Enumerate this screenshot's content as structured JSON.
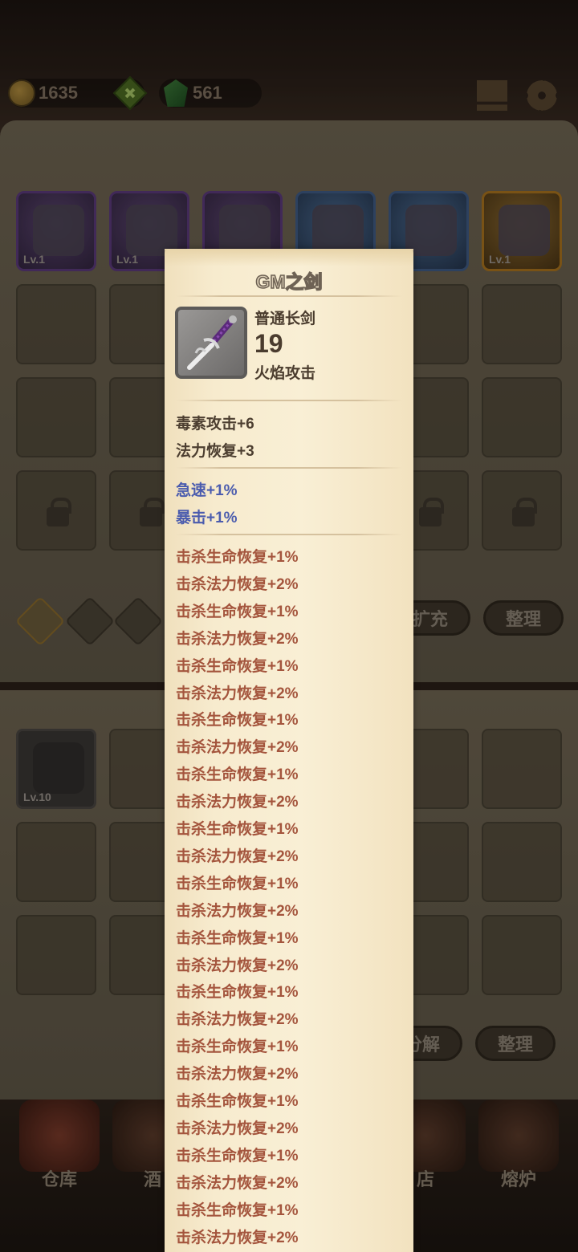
{
  "currency": {
    "gold": "1635",
    "gems": "561"
  },
  "equipment": [
    {
      "level": "Lv.1",
      "rarity": "purple"
    },
    {
      "level": "Lv.1",
      "rarity": "purple"
    },
    {
      "level": "",
      "rarity": "purple"
    },
    {
      "level": "",
      "rarity": "blue"
    },
    {
      "level": "0",
      "rarity": "blue"
    },
    {
      "level": "Lv.1",
      "rarity": "gold"
    }
  ],
  "bag_buttons": {
    "expand": "扩充",
    "sort": "整理"
  },
  "warehouse": {
    "item_level": "Lv.10",
    "decompose": "分解",
    "sort": "整理"
  },
  "nav": [
    {
      "label": "仓库"
    },
    {
      "label": "酒"
    },
    {
      "label": "店"
    },
    {
      "label": "熔炉"
    }
  ],
  "tooltip": {
    "title": "GM之剑",
    "item_type": "普通长剑",
    "power": "19",
    "attack_type": "火焰攻击",
    "base_stats": [
      "毒素攻击+6",
      "法力恢复+3"
    ],
    "blue_stats": [
      "急速+1%",
      "暴击+1%"
    ],
    "red_stats": [
      "击杀生命恢复+1%",
      "击杀法力恢复+2%",
      "击杀生命恢复+1%",
      "击杀法力恢复+2%",
      "击杀生命恢复+1%",
      "击杀法力恢复+2%",
      "击杀生命恢复+1%",
      "击杀法力恢复+2%",
      "击杀生命恢复+1%",
      "击杀法力恢复+2%",
      "击杀生命恢复+1%",
      "击杀法力恢复+2%",
      "击杀生命恢复+1%",
      "击杀法力恢复+2%",
      "击杀生命恢复+1%",
      "击杀法力恢复+2%",
      "击杀生命恢复+1%",
      "击杀法力恢复+2%",
      "击杀生命恢复+1%",
      "击杀法力恢复+2%",
      "击杀生命恢复+1%",
      "击杀法力恢复+2%",
      "击杀生命恢复+1%",
      "击杀法力恢复+2%",
      "击杀生命恢复+1%",
      "击杀法力恢复+2%"
    ]
  }
}
